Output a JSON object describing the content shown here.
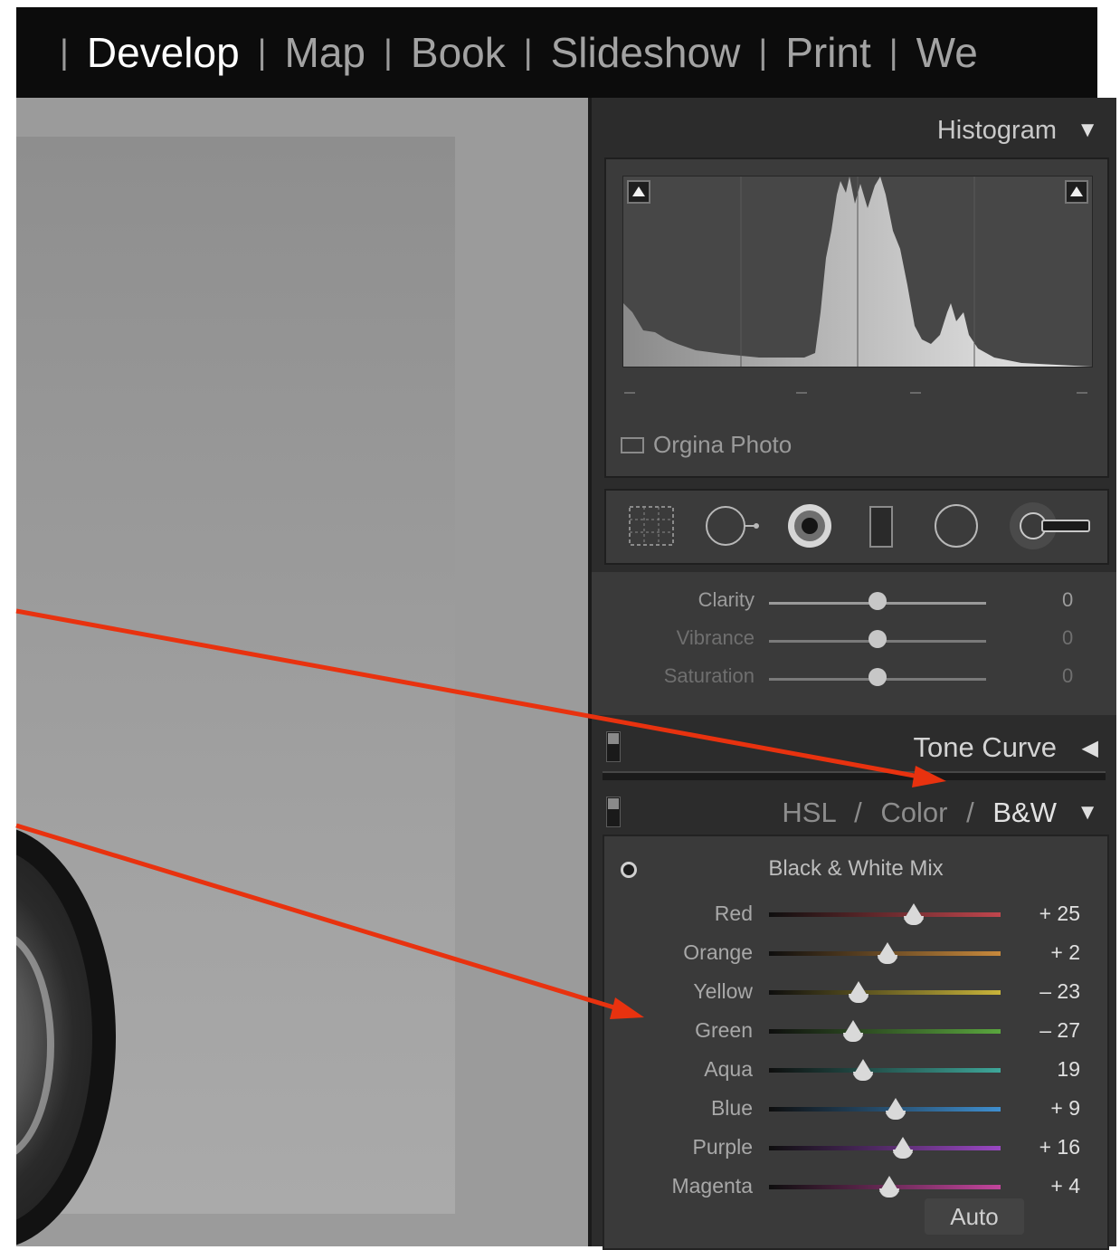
{
  "module_bar": {
    "modules": [
      {
        "label": "Develop",
        "active": true
      },
      {
        "label": "Map",
        "active": false
      },
      {
        "label": "Book",
        "active": false
      },
      {
        "label": "Slideshow",
        "active": false
      },
      {
        "label": "Print",
        "active": false
      },
      {
        "label": "We",
        "active": false
      }
    ]
  },
  "histogram": {
    "title": "Histogram",
    "collapse_icon": "triangle-down-icon",
    "original_photo_label": "Orgina Photo"
  },
  "tool_strip": {
    "tools": [
      "crop-overlay-icon",
      "spot-removal-icon",
      "red-eye-icon",
      "graduated-filter-icon",
      "radial-filter-icon",
      "adjustment-brush-icon"
    ]
  },
  "basic_presence": [
    {
      "label": "Clarity",
      "value": "0",
      "level": 0
    },
    {
      "label": "Vibrance",
      "value": "0",
      "level": 0
    },
    {
      "label": "Saturation",
      "value": "0",
      "level": 0
    }
  ],
  "tone_curve": {
    "title": "Tone Curve",
    "icon": "triangle-left-icon"
  },
  "hsl": {
    "title_hsl": "HSL",
    "title_color": "Color",
    "title_bw": "B&W",
    "separator": "/",
    "icon": "triangle-down-icon"
  },
  "bw_mix": {
    "title": "Black & White Mix",
    "auto_label": "Auto",
    "channels": [
      {
        "label": "Red",
        "value": "+ 25",
        "level": 25,
        "color": "#c0464d"
      },
      {
        "label": "Orange",
        "value": "+ 2",
        "level": 2,
        "color": "#c8893c"
      },
      {
        "label": "Yellow",
        "value": "– 23",
        "level": -23,
        "color": "#c9b43a"
      },
      {
        "label": "Green",
        "value": "– 27",
        "level": -27,
        "color": "#5aa63e"
      },
      {
        "label": "Aqua",
        "value": "19",
        "level": -19,
        "color": "#3ea79a"
      },
      {
        "label": "Blue",
        "value": "+ 9",
        "level": 9,
        "color": "#3f8fd0"
      },
      {
        "label": "Purple",
        "value": "+ 16",
        "level": 16,
        "color": "#9a48c4"
      },
      {
        "label": "Magenta",
        "value": "+ 4",
        "level": 4,
        "color": "#c2459c"
      }
    ]
  },
  "annotation": {
    "arrow_color": "#e8320f"
  }
}
